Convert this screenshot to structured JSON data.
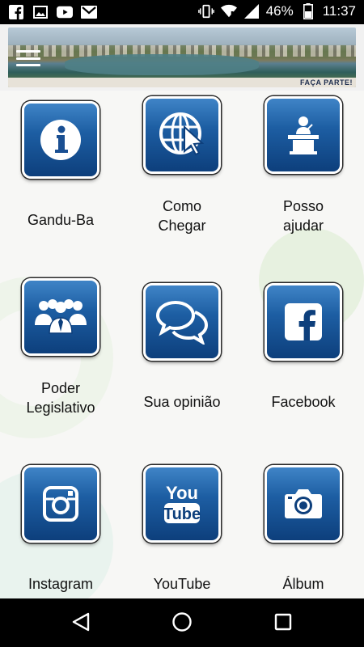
{
  "status_bar": {
    "battery": "46%",
    "time": "11:37",
    "icons": [
      "facebook-icon",
      "image-icon",
      "youtube-icon",
      "gmail-icon",
      "vibrate-icon",
      "wifi-icon",
      "signal-icon",
      "battery-icon"
    ]
  },
  "header": {
    "banner_tag": "FAÇA PARTE!"
  },
  "grid": [
    {
      "label": "Gandu-Ba",
      "icon": "info-icon"
    },
    {
      "label": "Como\nChegar",
      "icon": "globe-cursor-icon"
    },
    {
      "label": "Posso\najudar",
      "icon": "podium-icon"
    },
    {
      "label": "Poder\nLegislativo",
      "icon": "group-icon"
    },
    {
      "label": "Sua opinião",
      "icon": "chat-bubbles-icon"
    },
    {
      "label": "Facebook",
      "icon": "facebook-icon"
    },
    {
      "label": "Instagram",
      "icon": "instagram-icon"
    },
    {
      "label": "YouTube",
      "icon": "youtube-icon"
    },
    {
      "label": "Álbum",
      "icon": "camera-icon"
    }
  ],
  "colors": {
    "tile_top": "#3f84c7",
    "tile_bottom": "#0d3f7c",
    "status_bar": "#000000",
    "background": "#f7f7f5"
  }
}
